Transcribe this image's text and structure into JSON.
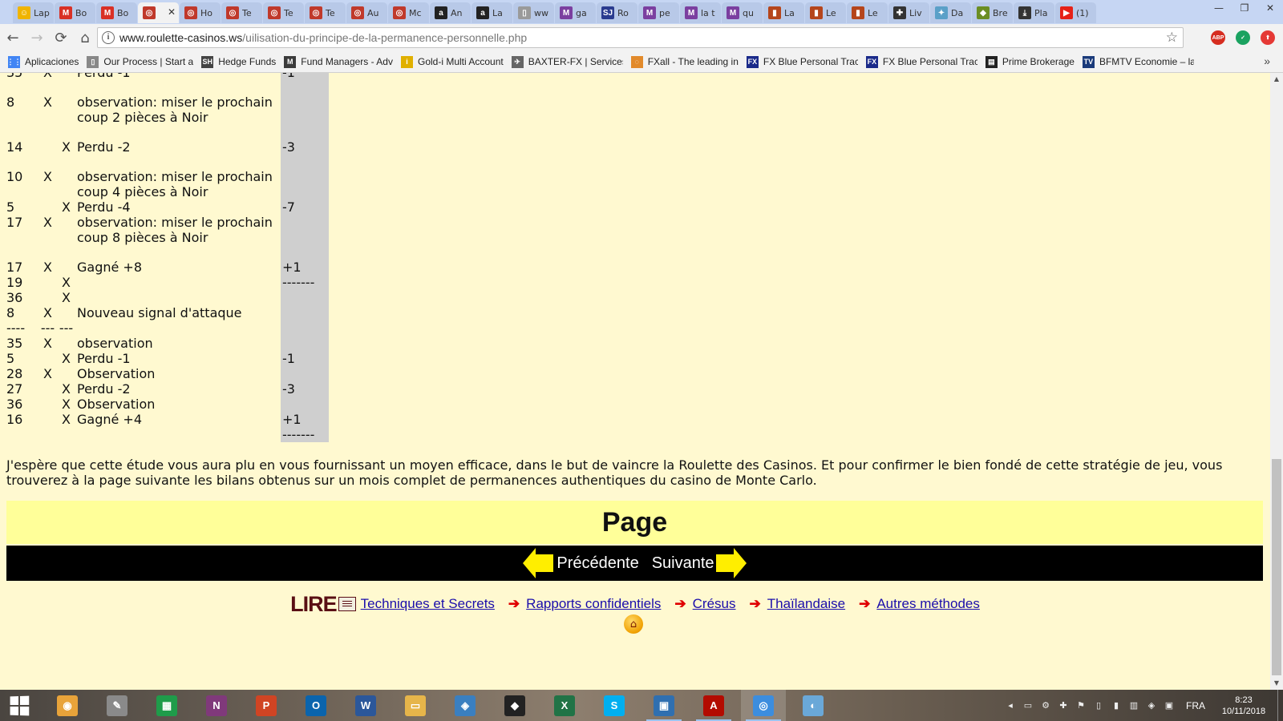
{
  "browser": {
    "tabs": [
      {
        "title": "Lap",
        "icon": "chat-icon",
        "color": "#f0b400",
        "glyph": "☺"
      },
      {
        "title": "Bo",
        "icon": "gmail-icon",
        "color": "#d93025",
        "glyph": "M"
      },
      {
        "title": "Bo",
        "icon": "gmail-icon",
        "color": "#d93025",
        "glyph": "M"
      },
      {
        "title": "",
        "icon": "roulette-icon",
        "color": "#c0392b",
        "glyph": "◎",
        "active": true,
        "close": "✕"
      },
      {
        "title": "Ho",
        "icon": "roulette-icon",
        "color": "#c0392b",
        "glyph": "◎"
      },
      {
        "title": "Te",
        "icon": "roulette-icon",
        "color": "#c0392b",
        "glyph": "◎"
      },
      {
        "title": "Te",
        "icon": "roulette-icon",
        "color": "#c0392b",
        "glyph": "◎"
      },
      {
        "title": "Te",
        "icon": "roulette-icon",
        "color": "#c0392b",
        "glyph": "◎"
      },
      {
        "title": "Au",
        "icon": "roulette-icon",
        "color": "#c0392b",
        "glyph": "◎"
      },
      {
        "title": "Mc",
        "icon": "roulette-icon",
        "color": "#c0392b",
        "glyph": "◎"
      },
      {
        "title": "An",
        "icon": "amazon-icon",
        "color": "#222222",
        "glyph": "a"
      },
      {
        "title": "La",
        "icon": "amazon-icon",
        "color": "#222222",
        "glyph": "a"
      },
      {
        "title": "ww",
        "icon": "page-icon",
        "color": "#9a9a9a",
        "glyph": "▯"
      },
      {
        "title": "ga",
        "icon": "m-icon",
        "color": "#7b3fa0",
        "glyph": "M"
      },
      {
        "title": "Ro",
        "icon": "sj-icon",
        "color": "#2a3b8f",
        "glyph": "SJ"
      },
      {
        "title": "pe",
        "icon": "m-icon",
        "color": "#7b3fa0",
        "glyph": "M"
      },
      {
        "title": "la t",
        "icon": "m-icon",
        "color": "#7b3fa0",
        "glyph": "M"
      },
      {
        "title": "qu",
        "icon": "m-icon",
        "color": "#7b3fa0",
        "glyph": "M"
      },
      {
        "title": "La",
        "icon": "book-red-icon",
        "color": "#b5451b",
        "glyph": "▮"
      },
      {
        "title": "Le",
        "icon": "book-red-icon",
        "color": "#b5451b",
        "glyph": "▮"
      },
      {
        "title": "Le",
        "icon": "book-red-icon",
        "color": "#b5451b",
        "glyph": "▮"
      },
      {
        "title": "Liv",
        "icon": "plus-icon",
        "color": "#333333",
        "glyph": "✚"
      },
      {
        "title": "Da",
        "icon": "bird-icon",
        "color": "#5aa0c8",
        "glyph": "✦"
      },
      {
        "title": "Bre",
        "icon": "game-icon",
        "color": "#6b8e23",
        "glyph": "◆"
      },
      {
        "title": "Pla",
        "icon": "download-icon",
        "color": "#333333",
        "glyph": "⤓"
      },
      {
        "title": "(1)",
        "icon": "youtube-icon",
        "color": "#e62117",
        "glyph": "▶"
      }
    ],
    "window_controls": {
      "minimize": "—",
      "maximize": "❐",
      "close": "✕"
    },
    "nav": {
      "back": "←",
      "forward": "→",
      "reload": "⟳",
      "home": "⌂"
    },
    "url": {
      "host": "www.roulette-casinos.ws",
      "path": "/uilisation-du-principe-de-la-permanence-personnelle.php"
    },
    "info_glyph": "i",
    "star_glyph": "☆",
    "extensions": [
      {
        "name": "adblock-icon",
        "label": "ABP",
        "color": "#d62d20"
      },
      {
        "name": "check-icon",
        "label": "✓",
        "color": "#1aa260"
      },
      {
        "name": "update-icon",
        "label": "⬆",
        "color": "#e53935"
      }
    ],
    "bookmarks": [
      {
        "label": "Aplicaciones",
        "icon": "apps-icon",
        "color": "#4285f4",
        "glyph": "⋮⋮"
      },
      {
        "label": "Our Process | Start a",
        "icon": "page-icon",
        "color": "#888888",
        "glyph": "▯"
      },
      {
        "label": "Hedge Funds",
        "icon": "sh-icon",
        "color": "#444444",
        "glyph": "SH"
      },
      {
        "label": "Fund Managers - Adv",
        "icon": "fm-icon",
        "color": "#3b3b3b",
        "glyph": "M"
      },
      {
        "label": "Gold-i Multi Account",
        "icon": "gold-icon",
        "color": "#e0b000",
        "glyph": "i"
      },
      {
        "label": "BAXTER-FX | Services",
        "icon": "baxter-icon",
        "color": "#666666",
        "glyph": "✈"
      },
      {
        "label": "FXall - The leading in",
        "icon": "fxall-icon",
        "color": "#e28a2b",
        "glyph": "◌"
      },
      {
        "label": "FX Blue Personal Trac",
        "icon": "fxblue-icon",
        "color": "#1a2a8a",
        "glyph": "FX"
      },
      {
        "label": "FX Blue Personal Trac",
        "icon": "fxblue-icon",
        "color": "#1a2a8a",
        "glyph": "FX"
      },
      {
        "label": "Prime Brokerage",
        "icon": "prime-icon",
        "color": "#222222",
        "glyph": "▤"
      },
      {
        "label": "BFMTV Economie – la",
        "icon": "bfm-icon",
        "color": "#1a3a7a",
        "glyph": "TV"
      }
    ],
    "bookmarks_more": "»"
  },
  "page": {
    "rows": [
      {
        "num": "35",
        "c1": "X",
        "c2": "",
        "obs": "Perdu -1",
        "res": "-1",
        "gap": false
      },
      {
        "num": "",
        "c1": "",
        "c2": "",
        "obs": "",
        "res": "",
        "gap": true
      },
      {
        "num": "8",
        "c1": "X",
        "c2": "",
        "obs": "observation: miser le prochain coup 2 pièces à Noir",
        "res": "",
        "gap": false
      },
      {
        "num": "",
        "c1": "",
        "c2": "",
        "obs": "",
        "res": "",
        "gap": true
      },
      {
        "num": "14",
        "c1": "",
        "c2": "X",
        "obs": "Perdu -2",
        "res": "-3",
        "gap": false
      },
      {
        "num": "",
        "c1": "",
        "c2": "",
        "obs": "",
        "res": "",
        "gap": true
      },
      {
        "num": "10",
        "c1": "X",
        "c2": "",
        "obs": "observation: miser le prochain coup 4 pièces à Noir",
        "res": "",
        "gap": false
      },
      {
        "num": "5",
        "c1": "",
        "c2": "X",
        "obs": "Perdu -4",
        "res": "-7",
        "gap": false
      },
      {
        "num": "17",
        "c1": "X",
        "c2": "",
        "obs": "observation: miser le prochain coup 8 pièces à Noir",
        "res": "",
        "gap": false
      },
      {
        "num": "",
        "c1": "",
        "c2": "",
        "obs": "",
        "res": "",
        "gap": true
      },
      {
        "num": "17",
        "c1": "X",
        "c2": "",
        "obs": "Gagné +8",
        "res": "+1",
        "gap": false
      },
      {
        "num": "19",
        "c1": "",
        "c2": "X",
        "obs": "",
        "res": "-------",
        "gap": false
      },
      {
        "num": "36",
        "c1": "",
        "c2": "X",
        "obs": "",
        "res": "",
        "gap": false
      },
      {
        "num": "8",
        "c1": "X",
        "c2": "",
        "obs": "Nouveau signal d'attaque",
        "res": "",
        "gap": false
      },
      {
        "num": "----",
        "c1": "---",
        "c2": "---",
        "obs": "",
        "res": "",
        "gap": false
      },
      {
        "num": "35",
        "c1": "X",
        "c2": "",
        "obs": "observation",
        "res": "",
        "gap": false
      },
      {
        "num": "5",
        "c1": "",
        "c2": "X",
        "obs": "Perdu -1",
        "res": "-1",
        "gap": false
      },
      {
        "num": "28",
        "c1": "X",
        "c2": "",
        "obs": "Observation",
        "res": "",
        "gap": false
      },
      {
        "num": "27",
        "c1": "",
        "c2": "X",
        "obs": "Perdu -2",
        "res": "-3",
        "gap": false
      },
      {
        "num": "36",
        "c1": "",
        "c2": "X",
        "obs": "Observation",
        "res": "",
        "gap": false
      },
      {
        "num": "16",
        "c1": "",
        "c2": "X",
        "obs": "Gagné +4",
        "res": "+1",
        "gap": false
      },
      {
        "num": "",
        "c1": "",
        "c2": "",
        "obs": "",
        "res": "-------",
        "gap": false
      }
    ],
    "conclusion": "J'espère que cette étude vous aura plu en vous fournissant un moyen efficace, dans le but de vaincre la Roulette des Casinos. Et pour confirmer le bien fondé de cette stratégie de jeu, vous trouverez à la page suivante les bilans obtenus sur un mois complet de permanences authentiques du casino de Monte Carlo.",
    "banner_title": "Page",
    "prev_label": "Précédente",
    "next_label": "Suivante",
    "lire_label": "LIRE",
    "links": [
      "Techniques et Secrets",
      "Rapports confidentiels",
      "Crésus",
      "Thaïlandaise",
      "Autres méthodes"
    ],
    "link_arrow": "➔",
    "home_glyph": "⌂",
    "background_color": "#fff9d0",
    "result_column_color": "#cfcfcf"
  },
  "scrollbar": {
    "up": "▲",
    "down": "▼"
  },
  "taskbar": {
    "apps": [
      {
        "name": "taskbar-browser-color-icon",
        "glyph": "◉",
        "color": "#e8a33a",
        "open": false
      },
      {
        "name": "taskbar-paint-tool-icon",
        "glyph": "✎",
        "color": "#8a8a8a",
        "open": false
      },
      {
        "name": "taskbar-store-icon",
        "glyph": "▦",
        "color": "#1f9c4a",
        "open": false
      },
      {
        "name": "taskbar-onenote-icon",
        "glyph": "N",
        "color": "#80397b",
        "open": false
      },
      {
        "name": "taskbar-powerpoint-icon",
        "glyph": "P",
        "color": "#d04423",
        "open": false
      },
      {
        "name": "taskbar-outlook-icon",
        "glyph": "O",
        "color": "#0a64ad",
        "open": false
      },
      {
        "name": "taskbar-word-icon",
        "glyph": "W",
        "color": "#2b579a",
        "open": false
      },
      {
        "name": "taskbar-explorer-icon",
        "glyph": "▭",
        "color": "#e6b54a",
        "open": false
      },
      {
        "name": "taskbar-owl-icon",
        "glyph": "◈",
        "color": "#3a7fc0",
        "open": false
      },
      {
        "name": "taskbar-cat-icon",
        "glyph": "◆",
        "color": "#222222",
        "open": false
      },
      {
        "name": "taskbar-excel-icon",
        "glyph": "X",
        "color": "#217346",
        "open": false
      },
      {
        "name": "taskbar-skype-icon",
        "glyph": "S",
        "color": "#00aff0",
        "open": false
      },
      {
        "name": "taskbar-remote-icon",
        "glyph": "▣",
        "color": "#2f6fb0",
        "open": true
      },
      {
        "name": "taskbar-acrobat-icon",
        "glyph": "A",
        "color": "#b30b00",
        "open": true
      },
      {
        "name": "taskbar-chrome-icon",
        "glyph": "◎",
        "color": "#3c8dde",
        "open": true,
        "active": true
      },
      {
        "name": "taskbar-paint-icon",
        "glyph": "◐",
        "color": "#6aa8d8",
        "open": false
      }
    ],
    "tray_icons": [
      "◂",
      "▭",
      "⚙",
      "✚",
      "⚑",
      "▯",
      "▮",
      "▥",
      "◈",
      "▣"
    ],
    "language": "FRA",
    "time": "8:23",
    "date": "10/11/2018"
  }
}
